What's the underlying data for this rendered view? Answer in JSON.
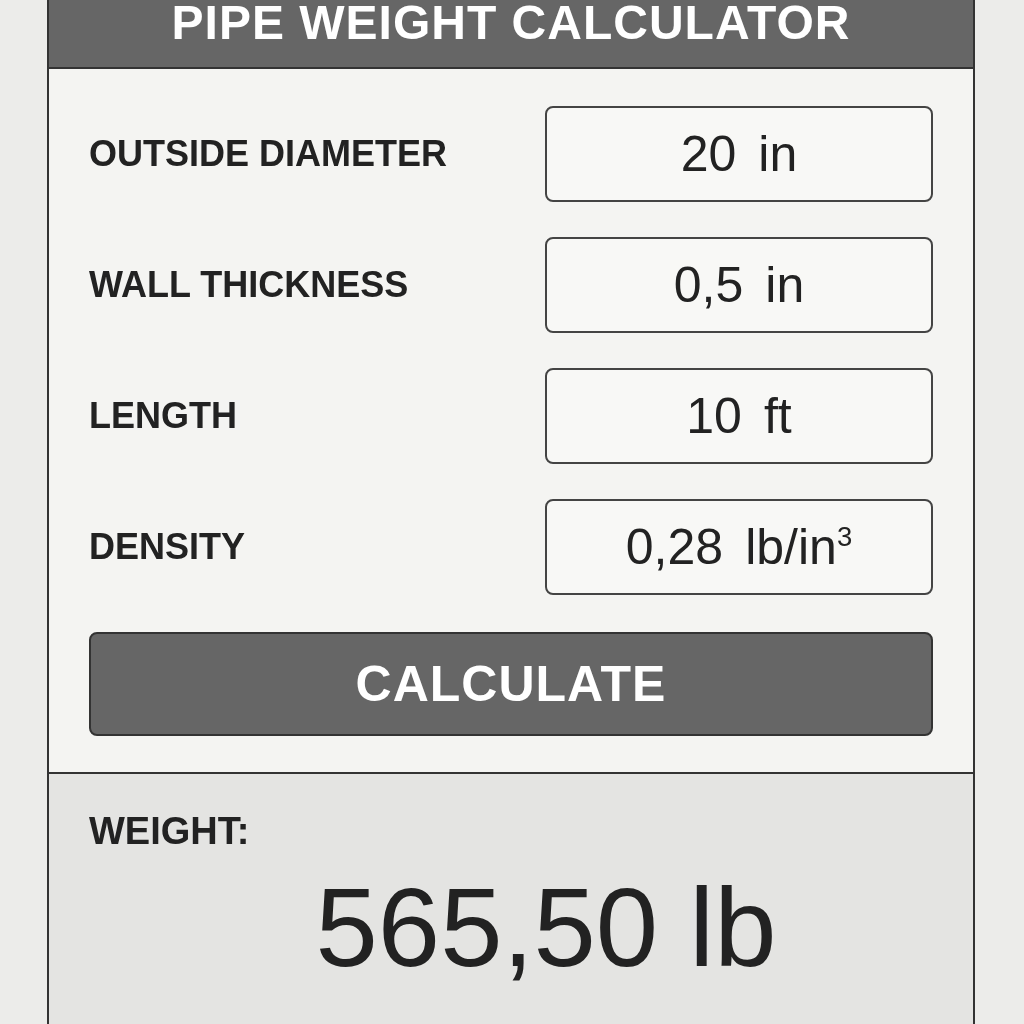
{
  "header": {
    "title": "PIPE WEIGHT CALCULATOR"
  },
  "fields": [
    {
      "label": "OUTSIDE DIAMETER",
      "value": "20",
      "unit": "in"
    },
    {
      "label": "WALL THICKNESS",
      "value": "0,5",
      "unit": "in"
    },
    {
      "label": "LENGTH",
      "value": "10",
      "unit": "ft"
    },
    {
      "label": "DENSITY",
      "value": "0,28",
      "unit": "lb/in$^{3}$"
    }
  ],
  "button": {
    "label": "CALCULATE"
  },
  "result": {
    "label": "WEIGHT:",
    "value": "565,50 lb"
  }
}
